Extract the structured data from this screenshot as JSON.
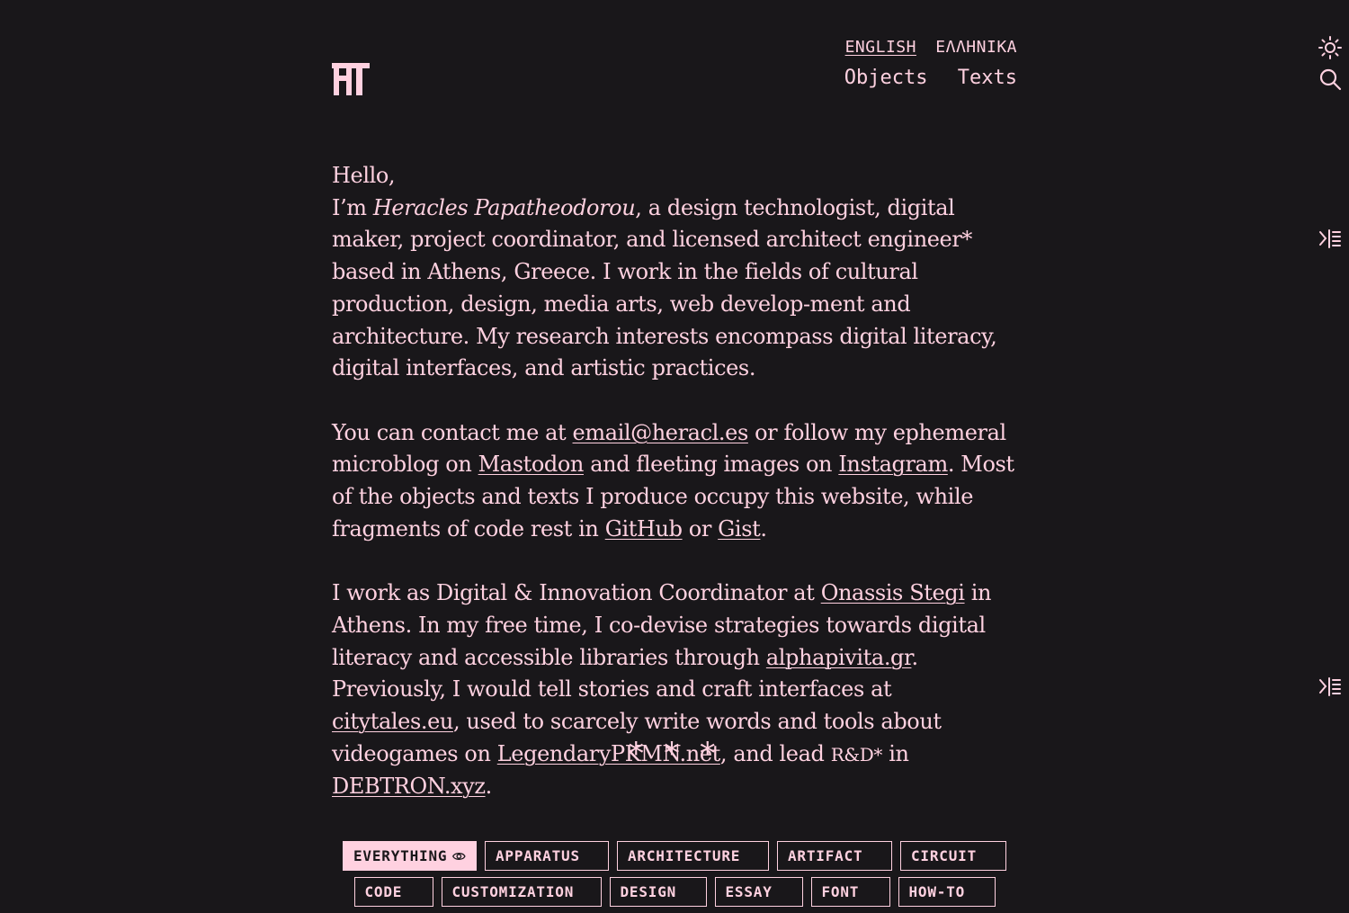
{
  "header": {
    "logo": "HT",
    "languages": [
      "ENGLISH",
      "ΕΛΛΗΝΙΚΑ"
    ],
    "active_language": "ENGLISH",
    "nav": [
      "Objects",
      "Texts"
    ]
  },
  "side_icons": [
    "theme-toggle-icon",
    "search-icon",
    "outline-icon",
    "outline-icon"
  ],
  "intro": {
    "greeting": "Hello,",
    "im": "I’m ",
    "name": "Heracles Papatheodorou",
    "p1_rest": ", a design technologist, digital maker, project coordinator, and licensed architect engineer* based in Athens, Greece. I work in the fields of cultural production, design, media arts, web develop-ment and architecture. My research interests encompass digital literacy, digital interfaces, and artistic practices.",
    "p2_a": "You can contact me at ",
    "email": "email@heracl.es",
    "p2_b": " or follow my ephemeral microblog on ",
    "mastodon": "Mastodon",
    "p2_c": " and fleeting images on ",
    "instagram": "Instagram",
    "p2_d": ". Most of the objects and texts I produce occupy this website, while fragments of code rest in ",
    "github": "GitHub",
    "p2_e": " or ",
    "gist": "Gist",
    "p2_f": ".",
    "p3_a": "I work as Digital & Innovation Coordinator at ",
    "onassis": "Onassis Stegi",
    "p3_b": " in Athens. In my free time, I co-devise strategies towards digital literacy and accessible libraries through ",
    "alphapivita": "alphapivita.gr",
    "p3_c": ". Previously, I would tell stories and craft interfaces at ",
    "citytales": "citytales.eu",
    "p3_d": ", used to scarcely write words and tools about videogames on ",
    "legendary": "LegendaryPKMN.net",
    "p3_e": ", and lead ",
    "rd": "R&D*",
    "p3_f": " in ",
    "debtron": "DEBTRON.xyz",
    "p3_g": "."
  },
  "divider": "* * *",
  "tags": {
    "row1": [
      "EVERYTHING",
      "APPARATUS",
      "ARCHITECTURE",
      "ARTIFACT",
      "CIRCUIT"
    ],
    "row2": [
      "CODE",
      "CUSTOMIZATION",
      "DESIGN",
      "ESSAY",
      "FONT",
      "HOW-TO"
    ],
    "active": "EVERYTHING"
  }
}
